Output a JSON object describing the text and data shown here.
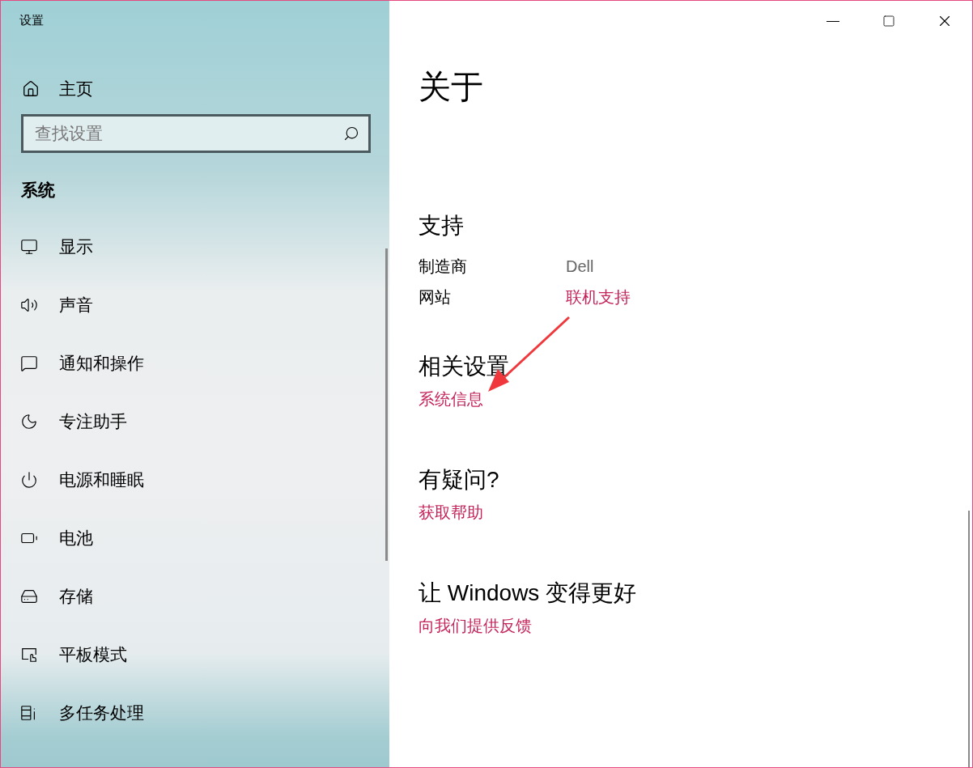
{
  "window": {
    "title": "设置"
  },
  "sidebar": {
    "home": "主页",
    "search": {
      "placeholder": "查找设置"
    },
    "section_title": "系统",
    "items": [
      {
        "kind": "display",
        "label": "显示"
      },
      {
        "kind": "sound",
        "label": "声音"
      },
      {
        "kind": "notifications",
        "label": "通知和操作"
      },
      {
        "kind": "focus",
        "label": "专注助手"
      },
      {
        "kind": "power",
        "label": "电源和睡眠"
      },
      {
        "kind": "battery",
        "label": "电池"
      },
      {
        "kind": "storage",
        "label": "存储"
      },
      {
        "kind": "tablet",
        "label": "平板模式"
      },
      {
        "kind": "multitask",
        "label": "多任务处理"
      }
    ]
  },
  "main": {
    "title": "关于",
    "support": {
      "heading": "支持",
      "rows": [
        {
          "label": "制造商",
          "value": "Dell",
          "kind": "text"
        },
        {
          "label": "网站",
          "value": "联机支持",
          "kind": "link"
        }
      ]
    },
    "sections": [
      {
        "heading": "相关设置",
        "link": "系统信息",
        "annotated": true
      },
      {
        "heading": "有疑问?",
        "link": "获取帮助",
        "annotated": false
      },
      {
        "heading": "让 Windows 变得更好",
        "link": "向我们提供反馈",
        "annotated": false
      }
    ]
  }
}
